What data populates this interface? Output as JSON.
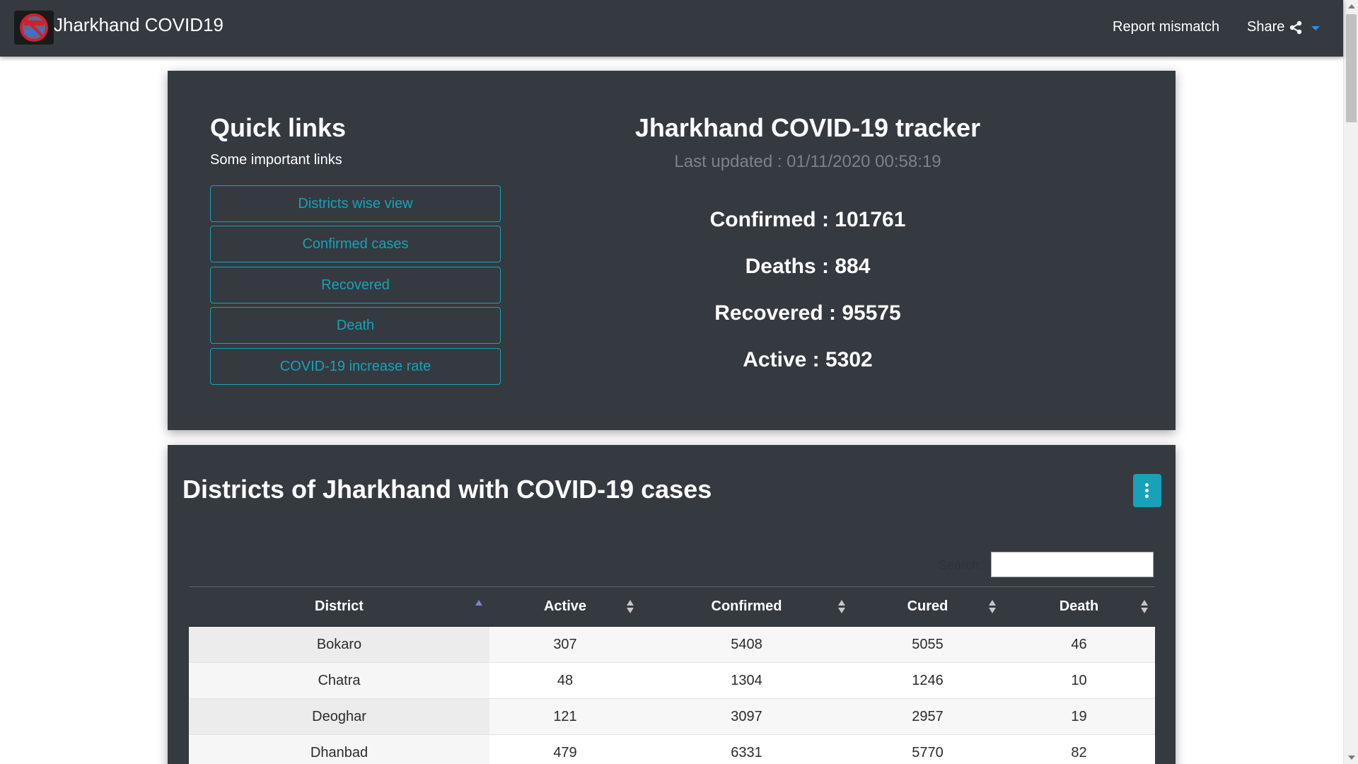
{
  "navbar": {
    "brand_title": "Jharkhand COVID19",
    "logo_icon": "corona-virus-logo",
    "report_label": "Report mismatch",
    "share_label": "Share",
    "share_icon": "share-icon",
    "caret_icon": "caret-down-icon"
  },
  "quick_links": {
    "title": "Quick links",
    "subtitle": "Some important links",
    "links": [
      {
        "label": "Districts wise view"
      },
      {
        "label": "Confirmed cases"
      },
      {
        "label": "Recovered"
      },
      {
        "label": "Death"
      },
      {
        "label": "COVID-19 increase rate"
      }
    ]
  },
  "tracker": {
    "title": "Jharkhand COVID-19 tracker",
    "last_updated": "Last updated : 01/11/2020 00:58:19",
    "confirmed": "Confirmed : 101761",
    "deaths": "Deaths : 884",
    "recovered": "Recovered : 95575",
    "active": "Active : 5302"
  },
  "districts": {
    "title": "Districts of Jharkhand with COVID-19 cases",
    "menu_icon": "kebab-menu-icon",
    "search_label": "Search:",
    "search_value": "",
    "columns": [
      "District",
      "Active",
      "Confirmed",
      "Cured",
      "Death"
    ],
    "sorted_column": "District",
    "sort_direction": "ascending",
    "rows": [
      [
        "Bokaro",
        "307",
        "5408",
        "5055",
        "46"
      ],
      [
        "Chatra",
        "48",
        "1304",
        "1246",
        "10"
      ],
      [
        "Deoghar",
        "121",
        "3097",
        "2957",
        "19"
      ],
      [
        "Dhanbad",
        "479",
        "6331",
        "5770",
        "82"
      ]
    ]
  },
  "colors": {
    "navbar_bg": "#343a40",
    "card_bg": "#343a40",
    "accent": "#17a2b8",
    "muted_text": "#7b8389",
    "sort_active": "#7a84d6"
  }
}
